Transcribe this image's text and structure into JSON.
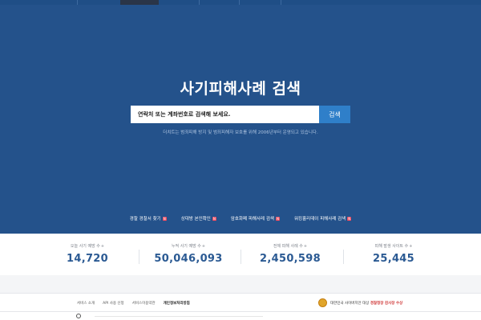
{
  "hero": {
    "title": "사기피해사례 검색",
    "search_placeholder": "연락처 또는 계좌번호로 검색해 보세요.",
    "search_button": "검색",
    "subtext": "더치트는 범죄피해 방지 및 범죄피해자 보호를 위해 2006년부터 운영되고 있습니다.",
    "quick_links": [
      {
        "label": "경찰 경찰서 찾기",
        "badge": "N"
      },
      {
        "label": "상대방 본인확인",
        "badge": "N"
      },
      {
        "label": "암호화폐 피해사례 검색",
        "badge": "N"
      },
      {
        "label": "워킹홀리데이 피해사례 검색",
        "badge": "N"
      }
    ]
  },
  "stats": [
    {
      "label": "오늘 사기 예방 수",
      "value": "14,720"
    },
    {
      "label": "누적 사기 예방 수",
      "value": "50,046,093"
    },
    {
      "label": "전체 피해 사례 수",
      "value": "2,450,598"
    },
    {
      "label": "피해 발생 사이트 수",
      "value": "25,445"
    }
  ],
  "footer": {
    "nav": [
      "서비스 소개",
      "API 사용 신청",
      "서비스이용약관",
      "개인정보처리방침"
    ],
    "badge_text": "대한민국 사이버치안 대상",
    "badge_highlight": "경찰청장 감사장 수상"
  }
}
